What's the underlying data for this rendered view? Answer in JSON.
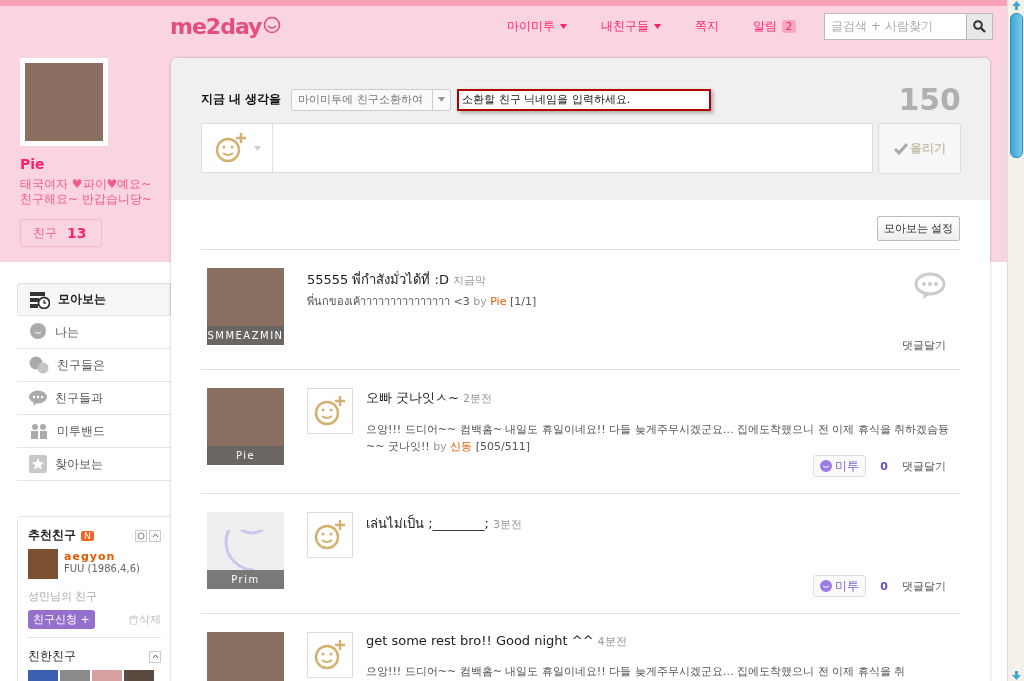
{
  "header": {
    "logo": "me2day",
    "nav": [
      {
        "label": "마이미투",
        "dropdown": true
      },
      {
        "label": "내친구들",
        "dropdown": true
      },
      {
        "label": "쪽지",
        "dropdown": false
      },
      {
        "label": "알림",
        "dropdown": false,
        "badge": "2"
      }
    ],
    "search": {
      "placeholder": "글검색 + 사람찾기"
    }
  },
  "profile": {
    "name": "Pie",
    "bio": [
      "태국여자 ♥파이♥예요~",
      "친구해요~ 반갑습니당~"
    ],
    "friends_label": "친구",
    "friends_count": "13"
  },
  "menu": [
    {
      "label": "모아보는",
      "selected": true
    },
    {
      "label": "나는",
      "selected": false
    },
    {
      "label": "친구들은",
      "selected": false
    },
    {
      "label": "친구들과",
      "selected": false
    },
    {
      "label": "미투밴드",
      "selected": false
    },
    {
      "label": "찾아보는",
      "selected": false
    }
  ],
  "recommend": {
    "title": "추천친구",
    "badge": "N",
    "name": "aegyon",
    "info": "FUU (1986,4,6)",
    "via": "성민님의 친구",
    "add": "친구신청 +",
    "delete": "삭제"
  },
  "close_friends": {
    "title": "친한친구",
    "photos": [
      {
        "color": "#3a5fb0"
      },
      {
        "color": "#8a8a8a"
      },
      {
        "color": "#d9a0a0"
      },
      {
        "color": "#5a4a40"
      }
    ]
  },
  "composer": {
    "label": "지금 내 생각을",
    "select": "마이미투에 친구소환하여",
    "nickname_placeholder": "소환할 친구 닉네임을 입력하세요.",
    "counter": "150",
    "submit": "올리기"
  },
  "settings_button": "모아보는 설정",
  "posts": [
    {
      "kind": "photo",
      "caption": "SMMEAZMIN",
      "emoticon": false,
      "text": "55555 พี่กำสังมั่วได้ที่ :D",
      "time": "지금막",
      "body": "พี่นกของเค้าาาาาาาาาาาาาาา <3",
      "ref": "[1/1]",
      "by": "by",
      "author": "Pie",
      "comment": "댓글달기"
    },
    {
      "kind": "photo",
      "caption": "Pie",
      "emoticon": true,
      "text": "오빠 굿나잇ㅅ~",
      "time": "2분전",
      "body": "으앙!!! 드디어~~ 컴백홈~ 내일도 휴일이네요!! 다들 늦게주무시겠군요… 집에도착했으니 전 이제 휴식을 취하겠슴듕~~ 굿나잇!!",
      "by": "by",
      "author": "신동",
      "ref": "[505/511]",
      "metoo": "미투",
      "metoo_count": "0",
      "comment": "댓글달기"
    },
    {
      "kind": "default",
      "caption": "Prim",
      "emoticon": true,
      "text": "เล่นไม่เป็น ;________;",
      "time": "3분전",
      "metoo": "미투",
      "metoo_count": "0",
      "comment": "댓글달기"
    },
    {
      "kind": "photo",
      "emoticon": true,
      "text": "get some rest bro!! Good night ^^",
      "time": "4분전",
      "body": "으앙!!! 드디어~~ 컴백홈~ 내일도 휴일이네요!! 다들 늦게주무시겠군요… 집에도착했으니 전 이제 휴식을 취"
    }
  ]
}
